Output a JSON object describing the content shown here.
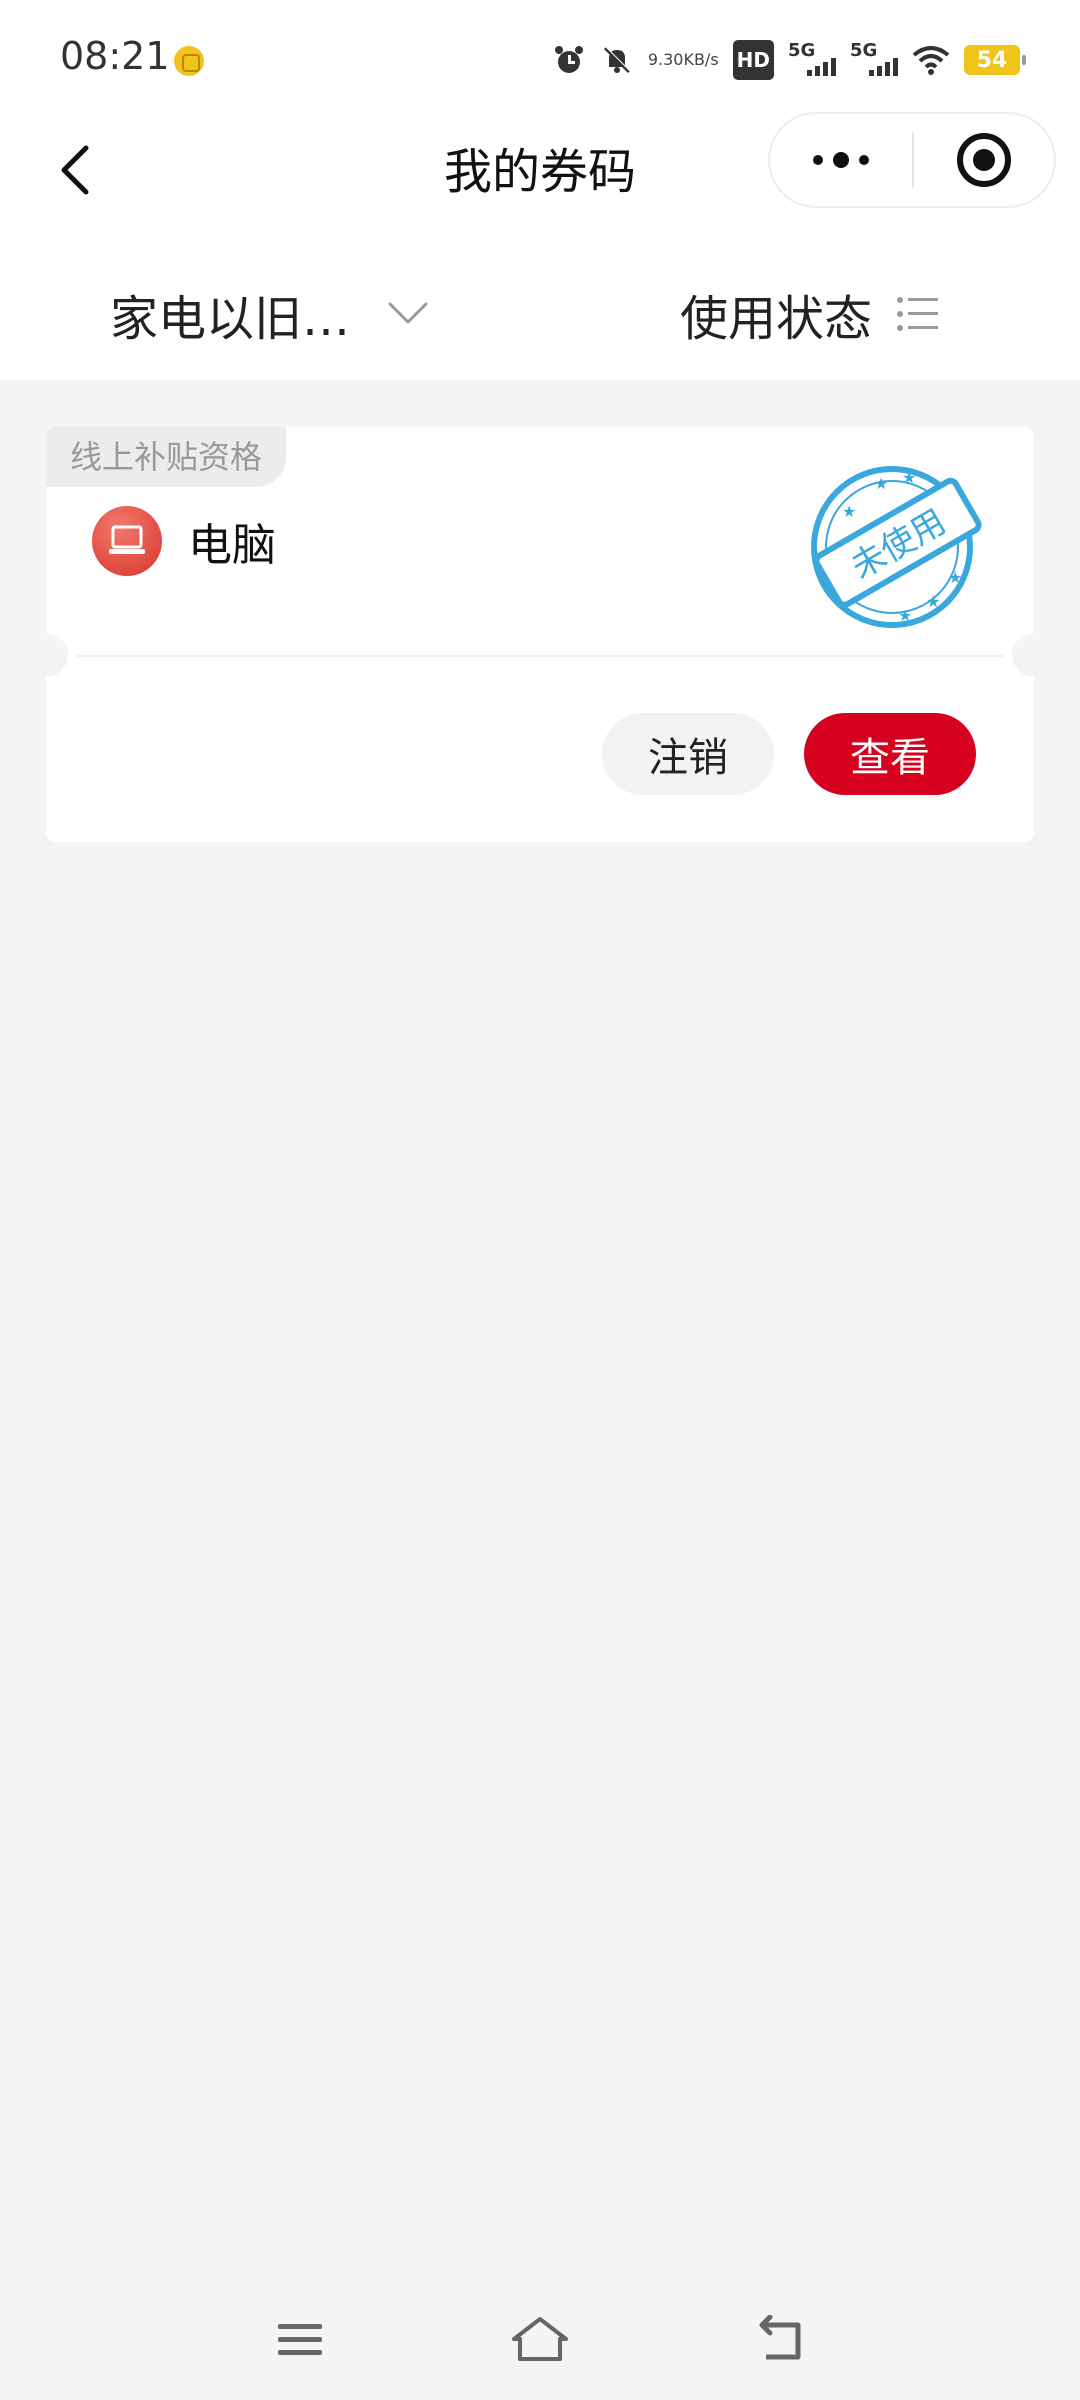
{
  "status_bar": {
    "time": "08:21",
    "net_speed_value": "9.30",
    "net_speed_unit": "KB/s",
    "hd_label": "HD",
    "signal1_label": "5G",
    "signal2_label": "5G",
    "battery": "54",
    "accent_battery": "#f0c419"
  },
  "nav": {
    "title": "我的券码"
  },
  "filters": {
    "category": "家电以旧…",
    "status": "使用状态"
  },
  "coupon": {
    "tag": "线上补贴资格",
    "item_name": "电脑",
    "stamp_text": "未使用",
    "icon": "laptop-icon",
    "cancel_label": "注销",
    "view_label": "查看",
    "accent": "#d6001f"
  }
}
